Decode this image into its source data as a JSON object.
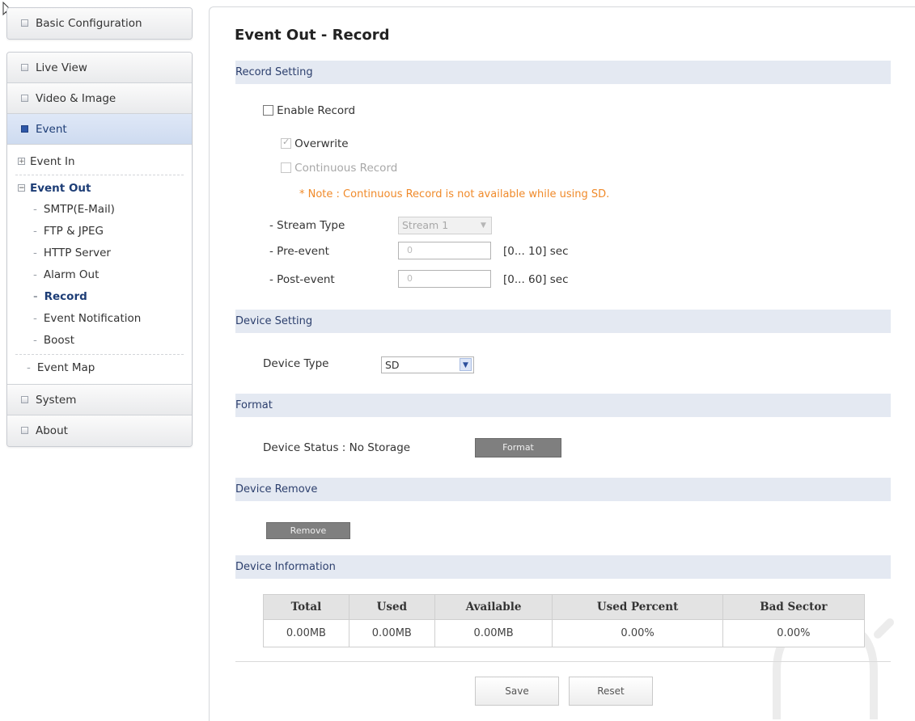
{
  "sidebar": {
    "basic_configuration": "Basic Configuration",
    "live_view": "Live View",
    "video_image": "Video & Image",
    "event": "Event",
    "event_in": "Event In",
    "event_out": "Event Out",
    "event_out_items": [
      "SMTP(E-Mail)",
      "FTP & JPEG",
      "HTTP Server",
      "Alarm Out",
      "Record",
      "Event Notification",
      "Boost"
    ],
    "event_map": "Event Map",
    "system": "System",
    "about": "About"
  },
  "page": {
    "title": "Event Out - Record"
  },
  "record_setting": {
    "header": "Record Setting",
    "enable_record": "Enable Record",
    "enable_record_checked": false,
    "overwrite": "Overwrite",
    "overwrite_checked": true,
    "continuous_record": "Continuous Record",
    "continuous_record_checked": false,
    "note": "* Note : Continuous Record is not available while using SD.",
    "stream_type_label": "- Stream Type",
    "stream_type_value": "Stream 1",
    "pre_event_label": "- Pre-event",
    "pre_event_value": "0",
    "pre_event_range": "[0... 10] sec",
    "post_event_label": "- Post-event",
    "post_event_value": "0",
    "post_event_range": "[0... 60] sec"
  },
  "device_setting": {
    "header": "Device Setting",
    "device_type_label": "Device Type",
    "device_type_value": "SD"
  },
  "format": {
    "header": "Format",
    "status": "Device Status : No Storage",
    "button": "Format"
  },
  "device_remove": {
    "header": "Device Remove",
    "button": "Remove"
  },
  "device_information": {
    "header": "Device Information",
    "columns": [
      "Total",
      "Used",
      "Available",
      "Used Percent",
      "Bad Sector"
    ],
    "values": [
      "0.00MB",
      "0.00MB",
      "0.00MB",
      "0.00%",
      "0.00%"
    ]
  },
  "actions": {
    "save": "Save",
    "reset": "Reset"
  },
  "colors": {
    "section_header_bg": "#e4e9f2",
    "note_orange": "#f08a2a",
    "active_blue": "#1d3d76"
  }
}
